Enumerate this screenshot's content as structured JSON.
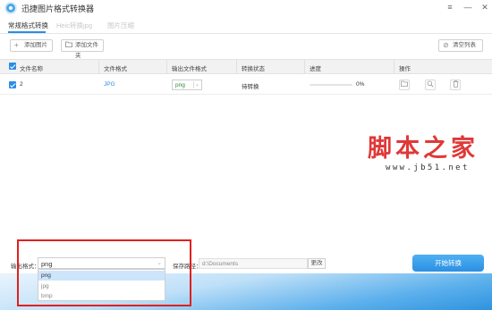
{
  "window": {
    "title": "迅捷图片格式转换器",
    "controls": {
      "menu": "≡",
      "minimize": "—",
      "close": "✕"
    }
  },
  "tabs": [
    {
      "label": "常规格式转换",
      "active": true
    },
    {
      "label": "Heic转换jpg",
      "active": false
    },
    {
      "label": "图片压缩",
      "active": false
    }
  ],
  "toolbar": {
    "add_image": "添加图片",
    "add_folder": "添加文件夹",
    "clear_list": "清空列表"
  },
  "table": {
    "columns": [
      "文件名称",
      "文件格式",
      "输出文件格式",
      "转换状态",
      "进度",
      "操作"
    ],
    "rows": [
      {
        "checked": true,
        "name": "2",
        "format": "JPG",
        "output_format": "png",
        "status": "待转换",
        "progress": 0,
        "progress_text": "0%"
      }
    ]
  },
  "watermark": {
    "main": "脚本之家",
    "url": "www.jb51.net",
    "color": "#e03838"
  },
  "bottom": {
    "output_format_label": "输出格式：",
    "output_format_value": "png",
    "dropdown_options": [
      {
        "label": "png",
        "selected": true
      },
      {
        "label": "jpg",
        "selected": false
      },
      {
        "label": "bmp",
        "selected": false
      }
    ],
    "save_path_label": "保存路径：",
    "save_path_value": "d:\\Documents",
    "change_label": "更改",
    "start_label": "开始转换"
  },
  "colors": {
    "accent": "#2a8de6",
    "highlight_box": "#e02020"
  }
}
